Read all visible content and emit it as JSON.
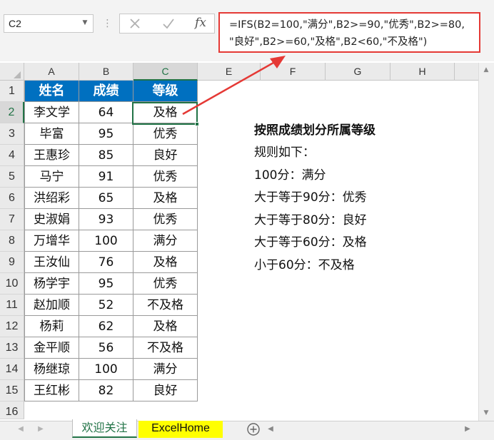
{
  "formula_bar": {
    "name_box": "C2",
    "dots": "⋮",
    "fx": "fx",
    "formula_line1": "=IFS(B2=100,\"满分\",B2>=90,\"优秀\",B2>=80,",
    "formula_line2": "\"良好\",B2>=60,\"及格\",B2<60,\"不及格\")"
  },
  "columns": [
    "A",
    "B",
    "C",
    "E",
    "F",
    "G",
    "H"
  ],
  "rows": [
    "1",
    "2",
    "3",
    "4",
    "5",
    "6",
    "7",
    "8",
    "9",
    "10",
    "11",
    "12",
    "13",
    "14",
    "15",
    "16"
  ],
  "table": {
    "headers": [
      "姓名",
      "成绩",
      "等级"
    ],
    "rows": [
      [
        "李文学",
        "64",
        "及格"
      ],
      [
        "毕富",
        "95",
        "优秀"
      ],
      [
        "王惠珍",
        "85",
        "良好"
      ],
      [
        "马宁",
        "91",
        "优秀"
      ],
      [
        "洪绍彩",
        "65",
        "及格"
      ],
      [
        "史淑娟",
        "93",
        "优秀"
      ],
      [
        "万增华",
        "100",
        "满分"
      ],
      [
        "王汝仙",
        "76",
        "及格"
      ],
      [
        "杨学宇",
        "95",
        "优秀"
      ],
      [
        "赵加顺",
        "52",
        "不及格"
      ],
      [
        "杨莉",
        "62",
        "及格"
      ],
      [
        "金平顺",
        "56",
        "不及格"
      ],
      [
        "杨继琼",
        "100",
        "满分"
      ],
      [
        "王红彬",
        "82",
        "良好"
      ]
    ]
  },
  "notes": {
    "title": "按照成绩划分所属等级",
    "lines": [
      "规则如下：",
      "100分：满分",
      "大于等于90分：优秀",
      "大于等于80分：良好",
      "大于等于60分：及格",
      "小于60分：不及格"
    ]
  },
  "sheet_tabs": [
    "欢迎关注",
    "ExcelHome"
  ],
  "colors": {
    "header_fill": "#0070c0",
    "selection": "#217346",
    "highlight_tab": "#ffff00",
    "callout": "#e53935"
  }
}
